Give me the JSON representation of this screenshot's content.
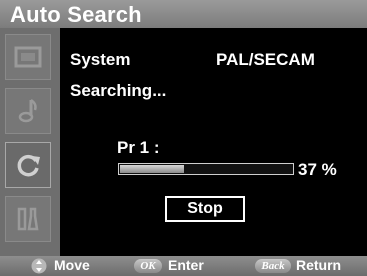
{
  "menu": {
    "title": "Auto Search"
  },
  "sidebar": {
    "items": [
      {
        "icon": "screen-icon"
      },
      {
        "icon": "music-note-icon"
      },
      {
        "icon": "refresh-icon",
        "active": true
      },
      {
        "icon": "tools-icon"
      }
    ]
  },
  "content": {
    "system_label": "System",
    "system_value": "PAL/SECAM",
    "status": "Searching...",
    "program_label": "Pr 1 :",
    "progress_fraction": 0.37,
    "progress_text": "37 %",
    "stop_label": "Stop"
  },
  "footer": {
    "move_label": "Move",
    "ok_badge": "OK",
    "enter_label": "Enter",
    "back_badge": "Back",
    "return_label": "Return"
  }
}
